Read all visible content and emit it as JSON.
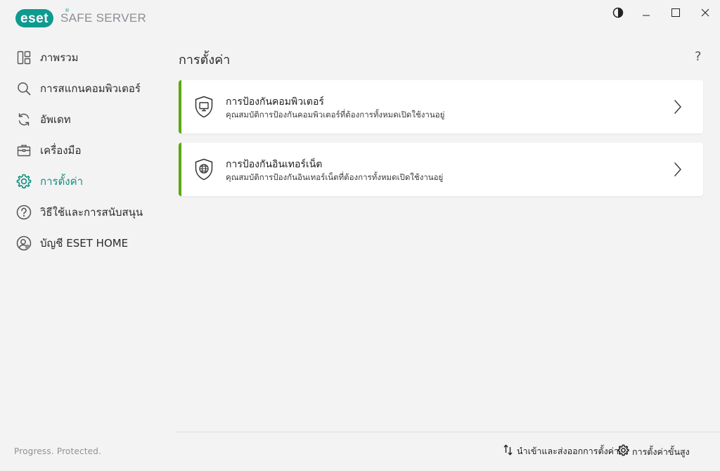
{
  "app": {
    "logo_text": "eset",
    "logo_reg": "®",
    "product_name": "SAFE SERVER"
  },
  "window_controls": {
    "icons": [
      "contrast-icon",
      "minimize-icon",
      "maximize-icon",
      "close-icon"
    ]
  },
  "sidebar": {
    "items": [
      {
        "label": "ภาพรวม",
        "icon": "overview-icon",
        "active": false
      },
      {
        "label": "การสแกนคอมพิวเตอร์",
        "icon": "search-icon",
        "active": false
      },
      {
        "label": "อัพเดท",
        "icon": "refresh-icon",
        "active": false
      },
      {
        "label": "เครื่องมือ",
        "icon": "toolbox-icon",
        "active": false
      },
      {
        "label": "การตั้งค่า",
        "icon": "gear-icon",
        "active": true
      },
      {
        "label": "วิธีใช้และการสนับสนุน",
        "icon": "help-icon",
        "active": false
      },
      {
        "label": "บัญชี ESET HOME",
        "icon": "account-icon",
        "active": false
      }
    ],
    "status_text": "Progress. Protected."
  },
  "main": {
    "title": "การตั้งค่า",
    "help_label": "?",
    "cards": [
      {
        "title": "การป้องกันคอมพิวเตอร์",
        "description": "คุณสมบัติการป้องกันคอมพิวเตอร์ที่ต้องการทั้งหมดเปิดใช้งานอยู่",
        "icon": "computer-shield-icon",
        "status_color": "#5ca80d"
      },
      {
        "title": "การป้องกันอินเทอร์เน็ต",
        "description": "คุณสมบัติการป้องกันอินเทอร์เน็ตที่ต้องการทั้งหมดเปิดใช้งานอยู่",
        "icon": "internet-shield-icon",
        "status_color": "#5ca80d"
      }
    ]
  },
  "footer": {
    "import_export_label": "นำเข้าและส่งออกการตั้งค่า",
    "advanced_setup_label": "การตั้งค่าขั้นสูง"
  },
  "colors": {
    "accent": "#0f9a8f",
    "ok_green": "#5ca80d",
    "background": "#f3f3f3"
  }
}
